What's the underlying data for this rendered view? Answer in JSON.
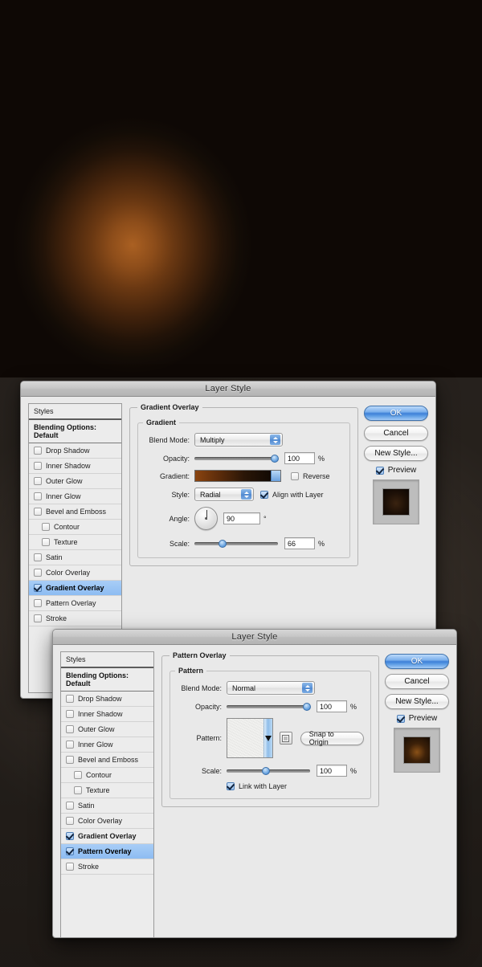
{
  "canvas": {
    "background_color": "#120c07",
    "glow_color": "#aa6022",
    "desktop_color": "#332c26"
  },
  "dialog1": {
    "title": "Layer Style",
    "styles_panel": {
      "styles_label": "Styles",
      "blending_options_label": "Blending Options: Default",
      "effects": [
        {
          "label": "Drop Shadow",
          "checked": false,
          "indent": false,
          "selected": false
        },
        {
          "label": "Inner Shadow",
          "checked": false,
          "indent": false,
          "selected": false
        },
        {
          "label": "Outer Glow",
          "checked": false,
          "indent": false,
          "selected": false
        },
        {
          "label": "Inner Glow",
          "checked": false,
          "indent": false,
          "selected": false
        },
        {
          "label": "Bevel and Emboss",
          "checked": false,
          "indent": false,
          "selected": false
        },
        {
          "label": "Contour",
          "checked": false,
          "indent": true,
          "selected": false
        },
        {
          "label": "Texture",
          "checked": false,
          "indent": true,
          "selected": false
        },
        {
          "label": "Satin",
          "checked": false,
          "indent": false,
          "selected": false
        },
        {
          "label": "Color Overlay",
          "checked": false,
          "indent": false,
          "selected": false
        },
        {
          "label": "Gradient Overlay",
          "checked": true,
          "indent": false,
          "selected": true
        },
        {
          "label": "Pattern Overlay",
          "checked": false,
          "indent": false,
          "selected": false
        },
        {
          "label": "Stroke",
          "checked": false,
          "indent": false,
          "selected": false
        }
      ]
    },
    "panel": {
      "group_title": "Gradient Overlay",
      "subgroup_title": "Gradient",
      "blend_mode_label": "Blend Mode:",
      "blend_mode_value": "Multiply",
      "opacity_label": "Opacity:",
      "opacity_value": "100",
      "opacity_unit": "%",
      "gradient_label": "Gradient:",
      "gradient_start_color": "#8a4410",
      "gradient_end_color": "#120a04",
      "reverse_label": "Reverse",
      "reverse_checked": false,
      "style_label": "Style:",
      "style_value": "Radial",
      "align_with_layer_label": "Align with Layer",
      "align_with_layer_checked": true,
      "angle_label": "Angle:",
      "angle_value": "90",
      "angle_unit": "°",
      "scale_label": "Scale:",
      "scale_value": "66",
      "scale_unit": "%"
    },
    "buttons": {
      "ok": "OK",
      "cancel": "Cancel",
      "new_style": "New Style...",
      "preview_label": "Preview",
      "preview_checked": true,
      "thumb_color": "#1d1007"
    }
  },
  "dialog2": {
    "title": "Layer Style",
    "styles_panel": {
      "styles_label": "Styles",
      "blending_options_label": "Blending Options: Default",
      "effects": [
        {
          "label": "Drop Shadow",
          "checked": false,
          "indent": false,
          "selected": false
        },
        {
          "label": "Inner Shadow",
          "checked": false,
          "indent": false,
          "selected": false
        },
        {
          "label": "Outer Glow",
          "checked": false,
          "indent": false,
          "selected": false
        },
        {
          "label": "Inner Glow",
          "checked": false,
          "indent": false,
          "selected": false
        },
        {
          "label": "Bevel and Emboss",
          "checked": false,
          "indent": false,
          "selected": false
        },
        {
          "label": "Contour",
          "checked": false,
          "indent": true,
          "selected": false
        },
        {
          "label": "Texture",
          "checked": false,
          "indent": true,
          "selected": false
        },
        {
          "label": "Satin",
          "checked": false,
          "indent": false,
          "selected": false
        },
        {
          "label": "Color Overlay",
          "checked": false,
          "indent": false,
          "selected": false
        },
        {
          "label": "Gradient Overlay",
          "checked": true,
          "indent": false,
          "selected": false
        },
        {
          "label": "Pattern Overlay",
          "checked": true,
          "indent": false,
          "selected": true
        },
        {
          "label": "Stroke",
          "checked": false,
          "indent": false,
          "selected": false
        }
      ]
    },
    "panel": {
      "group_title": "Pattern Overlay",
      "subgroup_title": "Pattern",
      "blend_mode_label": "Blend Mode:",
      "blend_mode_value": "Normal",
      "opacity_label": "Opacity:",
      "opacity_value": "100",
      "opacity_unit": "%",
      "pattern_label": "Pattern:",
      "snap_to_origin_label": "Snap to Origin",
      "scale_label": "Scale:",
      "scale_value": "100",
      "scale_unit": "%",
      "link_with_layer_label": "Link with Layer",
      "link_with_layer_checked": true
    },
    "buttons": {
      "ok": "OK",
      "cancel": "Cancel",
      "new_style": "New Style...",
      "preview_label": "Preview",
      "preview_checked": true,
      "thumb_color": "#3d2109"
    }
  }
}
